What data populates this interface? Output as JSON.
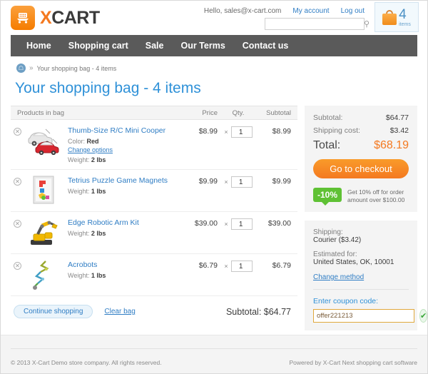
{
  "header": {
    "logo_x": "X",
    "logo_cart": "CART",
    "hello": "Hello, sales@x-cart.com",
    "my_account": "My account",
    "log_out": "Log out",
    "search_placeholder": "",
    "search_value": "",
    "search_icon": "search-icon",
    "cart_count": "4",
    "cart_items_label": "items"
  },
  "nav": {
    "items": [
      {
        "label": "Home"
      },
      {
        "label": "Shopping cart"
      },
      {
        "label": "Sale"
      },
      {
        "label": "Our Terms"
      },
      {
        "label": "Contact us"
      }
    ]
  },
  "breadcrumb": {
    "home_icon": "home-icon",
    "separator": "»",
    "current": "Your shopping bag - 4 items"
  },
  "page_title": "Your shopping bag - 4 items",
  "cart": {
    "columns": {
      "products": "Products in bag",
      "price": "Price",
      "qty": "Qty.",
      "subtotal": "Subtotal"
    },
    "multiply_symbol": "×",
    "remove_icon": "remove-item-icon",
    "rows": [
      {
        "name": "Thumb-Size R/C Mini Cooper",
        "option_label": "Color:",
        "option_value": "Red",
        "change_options": "Change options",
        "weight_label": "Weight:",
        "weight_value": "2 lbs",
        "price": "$8.99",
        "qty": "1",
        "subtotal": "$8.99"
      },
      {
        "name": "Tetrius Puzzle Game Magnets",
        "option_label": "",
        "option_value": "",
        "change_options": "",
        "weight_label": "Weight:",
        "weight_value": "1 lbs",
        "price": "$9.99",
        "qty": "1",
        "subtotal": "$9.99"
      },
      {
        "name": "Edge Robotic Arm Kit",
        "option_label": "",
        "option_value": "",
        "change_options": "",
        "weight_label": "Weight:",
        "weight_value": "2 lbs",
        "price": "$39.00",
        "qty": "1",
        "subtotal": "$39.00"
      },
      {
        "name": "Acrobots",
        "option_label": "",
        "option_value": "",
        "change_options": "",
        "weight_label": "Weight:",
        "weight_value": "1 lbs",
        "price": "$6.79",
        "qty": "1",
        "subtotal": "$6.79"
      }
    ],
    "continue_shopping": "Continue shopping",
    "clear_bag": "Clear bag",
    "footer_subtotal": "Subtotal: $64.77"
  },
  "summary": {
    "subtotal_label": "Subtotal:",
    "subtotal_value": "$64.77",
    "shipping_label": "Shipping cost:",
    "shipping_value": "$3.42",
    "total_label": "Total:",
    "total_value": "$68.19",
    "checkout_button": "Go to checkout",
    "promo_badge": "-10%",
    "promo_text": "Get 10% off for order amount over $100.00"
  },
  "shipping": {
    "shipping_label": "Shipping:",
    "shipping_method": "Courier ($3.42)",
    "estimated_label": "Estimated for:",
    "estimated_value": "United States, OK, 10001",
    "change_method": "Change method",
    "coupon_label": "Enter coupon code:",
    "coupon_value": "offer221213",
    "coupon_placeholder": "",
    "coupon_apply_icon": "checkmark-icon"
  },
  "footer": {
    "copyright": "© 2013 X-Cart Demo store company. All rights reserved.",
    "powered_by": "Powered by X-Cart Next shopping cart software"
  },
  "colors": {
    "brand_orange": "#f47920",
    "link_blue": "#2f7dc4",
    "title_blue": "#2f91d8",
    "nav_gray": "#5a5a5a",
    "promo_green": "#5fc134"
  }
}
